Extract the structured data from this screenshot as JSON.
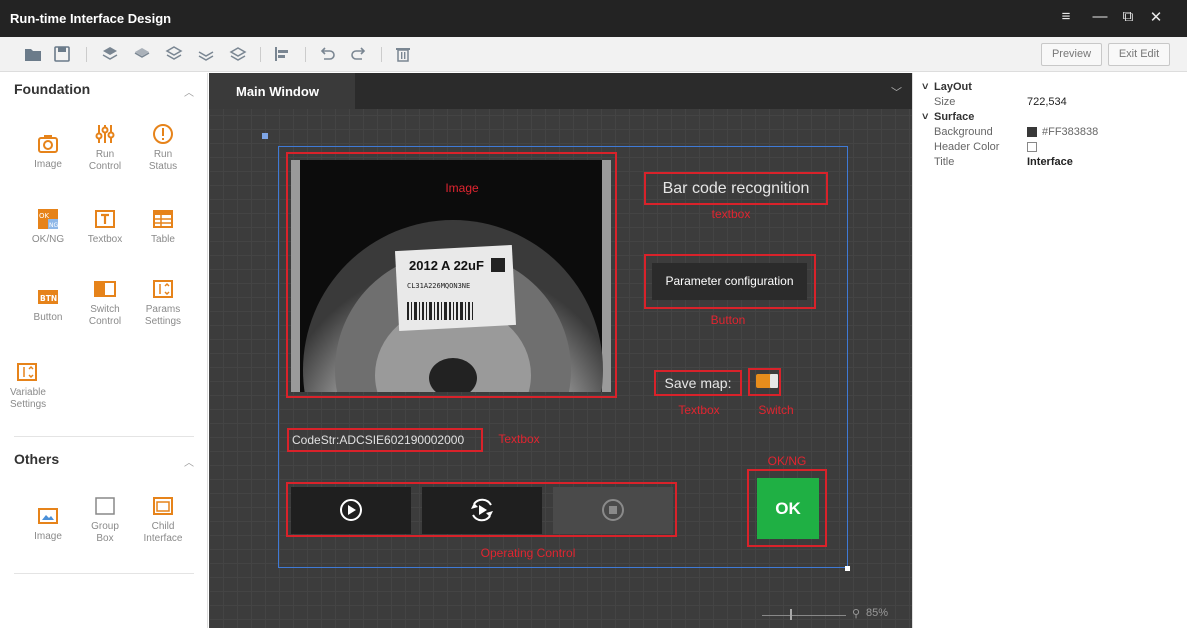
{
  "window": {
    "title": "Run-time Interface Design",
    "controls": {
      "menu": "≡",
      "minimize": "—",
      "restore": "⧉",
      "close": "✕"
    }
  },
  "toolbar": {
    "preview_label": "Preview",
    "exit_edit_label": "Exit Edit",
    "icons": [
      "open-folder-icon",
      "save-icon",
      "layer-up-icon",
      "layer-down-icon",
      "bring-front-icon",
      "send-back-icon",
      "align-icon",
      "undo-icon",
      "redo-icon",
      "delete-icon"
    ]
  },
  "left_panel": {
    "foundation": {
      "title": "Foundation",
      "items": [
        {
          "label": "Image"
        },
        {
          "label": "Run\nControl"
        },
        {
          "label": "Run\nStatus"
        },
        {
          "label": "OK/NG"
        },
        {
          "label": "Textbox"
        },
        {
          "label": "Table"
        },
        {
          "label": "Button"
        },
        {
          "label": "Switch\nControl"
        },
        {
          "label": "Params\nSettings"
        },
        {
          "label": "Variable\nSettings"
        }
      ]
    },
    "others": {
      "title": "Others",
      "items": [
        {
          "label": "Image"
        },
        {
          "label": "Group\nBox"
        },
        {
          "label": "Child\nInterface"
        }
      ]
    }
  },
  "canvas": {
    "tab_label": "Main Window",
    "image_label": "Image",
    "title_textbox_text": "Bar code recognition",
    "title_textbox_label": "textbox",
    "param_button_text": "Parameter configuration",
    "param_button_label": "Button",
    "savemap_text": "Save map:",
    "savemap_label": "Textbox",
    "switch_label": "Switch",
    "codestr_text": "CodeStr:ADCSIE602190002000",
    "codestr_label": "Textbox",
    "okng_label": "OK/NG",
    "ok_text": "OK",
    "operating_label": "Operating Control",
    "zoom_text": "85%",
    "reel_label": {
      "line1": "2012 A  22uF",
      "line2": "CL31A226MQON3NE"
    }
  },
  "right_panel": {
    "layout_title": "LayOut",
    "size_label": "Size",
    "size_value": "722,534",
    "surface_title": "Surface",
    "background_label": "Background",
    "background_value": "#FF383838",
    "header_color_label": "Header Color",
    "title_label": "Title",
    "title_value": "Interface"
  },
  "colors": {
    "accent_red": "#d9222a",
    "ok_green": "#1fb044",
    "switch_orange": "#e78d1c",
    "canvas_bg": "#383838"
  }
}
